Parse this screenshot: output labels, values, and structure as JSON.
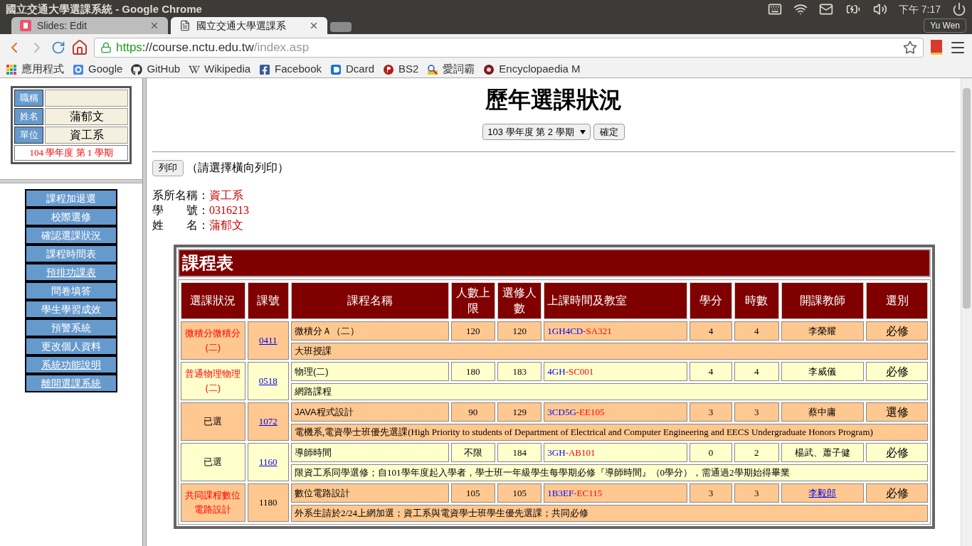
{
  "window": {
    "title": "國立交通大學選課系統 - Google Chrome"
  },
  "system_tray": {
    "clock": "下午 7:17",
    "user": "Yu Wen"
  },
  "tabs": [
    {
      "label": "Slides: Edit",
      "selected": false,
      "kind": "slides"
    },
    {
      "label": "國立交通大學選課系",
      "selected": true,
      "kind": "page"
    }
  ],
  "address_bar": {
    "scheme": "https",
    "host": "://course.nctu.edu.tw",
    "path": "/index.asp"
  },
  "bookmarks": [
    {
      "label": "應用程式",
      "kind": "apps"
    },
    {
      "label": "Google",
      "kind": "google"
    },
    {
      "label": "GitHub",
      "kind": "github"
    },
    {
      "label": "Wikipedia",
      "kind": "wikipedia"
    },
    {
      "label": "Facebook",
      "kind": "facebook"
    },
    {
      "label": "Dcard",
      "kind": "dcard"
    },
    {
      "label": "BS2",
      "kind": "bs2"
    },
    {
      "label": "愛詞霸",
      "kind": "dict"
    },
    {
      "label": "Encyclopaedia M",
      "kind": "encyclopedia"
    }
  ],
  "sidebar": {
    "profile": [
      {
        "label": "職稱"
      },
      {
        "label": "姓名",
        "value": "蒲郁文"
      },
      {
        "label": "單位",
        "value": "資工系"
      }
    ],
    "semester": "104 學年度 第 1 學期",
    "menu": [
      {
        "label": "課程加退選",
        "link": false
      },
      {
        "label": "校際選修",
        "link": false
      },
      {
        "label": "確認選課狀況",
        "link": false
      },
      {
        "label": "課程時間表",
        "link": false
      },
      {
        "label": "預排功課表",
        "link": true
      },
      {
        "label": "問卷填答",
        "link": false
      },
      {
        "label": "學生學習成效",
        "link": false
      },
      {
        "label": "預警系統",
        "link": false
      },
      {
        "label": "更改個人資料",
        "link": false
      },
      {
        "label": "系統功能說明",
        "link": true
      },
      {
        "label": "離開選課系統",
        "link": true
      }
    ]
  },
  "page": {
    "title": "歷年選課狀況",
    "semester_select": "103 學年度 第 2 學期",
    "confirm_button": "確定",
    "print_button": "列印",
    "print_note": "（請選擇橫向列印）",
    "info": [
      {
        "label": "系所名稱：",
        "value": "資工系"
      },
      {
        "label": "學　　號：",
        "value": "0316213"
      },
      {
        "label": "姓　　名：",
        "value": "蒲郁文"
      }
    ]
  },
  "table": {
    "title": "課程表",
    "columns": [
      "選課狀況",
      "課號",
      "課程名稱",
      "人數上限",
      "選修人數",
      "上課時間及教室",
      "學分",
      "時數",
      "開課教師",
      "選別"
    ],
    "rows": [
      {
        "status": "微積分微積分(二)",
        "status_alert": true,
        "code": "0411",
        "code_link": true,
        "name": "微積分Ａ（二）",
        "limit": "120",
        "enrolled": "120",
        "time": "1GH4CD",
        "room": "-SA321",
        "credits": "4",
        "hours": "4",
        "teacher": "李榮耀",
        "teacher_link": false,
        "type": "必修",
        "note": "大班授課"
      },
      {
        "status": "普通物理物理(二)",
        "status_alert": true,
        "code": "0518",
        "code_link": true,
        "name": "物理(二)",
        "limit": "180",
        "enrolled": "183",
        "time": "4GH",
        "room": "-SC001",
        "credits": "4",
        "hours": "4",
        "teacher": "李威儀",
        "teacher_link": false,
        "type": "必修",
        "note": "網路課程"
      },
      {
        "status": "已選",
        "status_alert": false,
        "code": "1072",
        "code_link": true,
        "name": "JAVA程式設計",
        "limit": "90",
        "enrolled": "129",
        "time": "3CD5G",
        "room": "-EE105",
        "credits": "3",
        "hours": "3",
        "teacher": "蔡中庸",
        "teacher_link": false,
        "type": "選修",
        "note": "電機系,電資學士班優先選課(High Priority to students of Department of Electrical and Computer Engineering and EECS Undergraduate Honors Program)"
      },
      {
        "status": "已選",
        "status_alert": false,
        "code": "1160",
        "code_link": true,
        "name": "導師時間",
        "limit": "不限",
        "enrolled": "184",
        "time": "3GH",
        "room": "-AB101",
        "credits": "0",
        "hours": "2",
        "teacher": "楊武、蕭子健",
        "teacher_link": false,
        "type": "必修",
        "note": "限資工系同學選修；自101學年度起入學者，學士班一年級學生每學期必修『導師時間』（0學分），需通過2學期始得畢業"
      },
      {
        "status": "共同課程數位電路設計",
        "status_alert": true,
        "code": "1180",
        "code_link": false,
        "name": "數位電路設計",
        "limit": "105",
        "enrolled": "105",
        "time": "1B3EF",
        "room": "-EC115",
        "credits": "3",
        "hours": "3",
        "teacher": "李毅郎",
        "teacher_link": true,
        "type": "必修",
        "note": "外系生請於2/24上網加選；資工系與電資學士班學生優先選課；共同必修"
      }
    ]
  }
}
